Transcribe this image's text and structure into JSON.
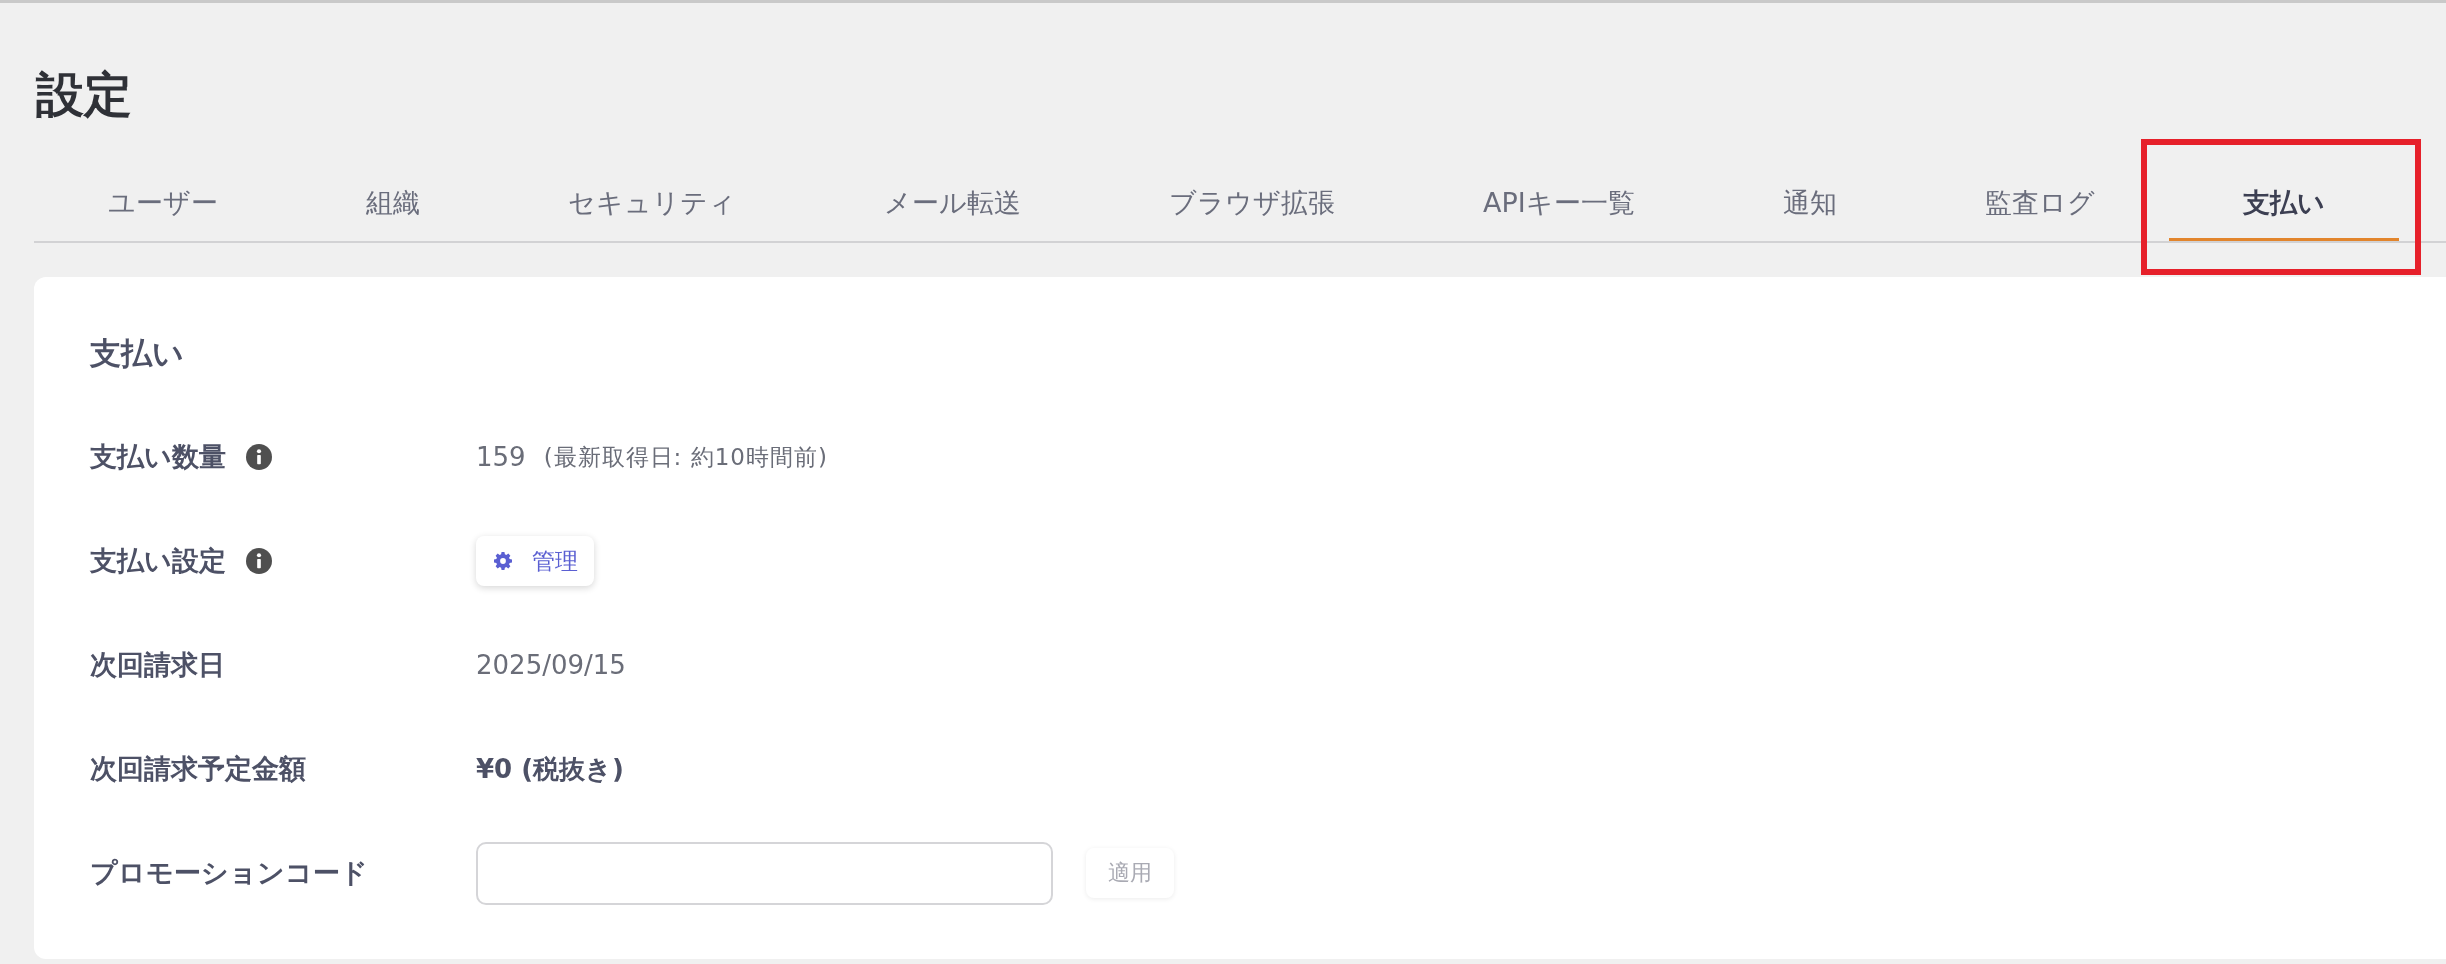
{
  "page": {
    "title": "設定"
  },
  "tabs": [
    {
      "label": "ユーザー",
      "selected": false,
      "highlighted": false
    },
    {
      "label": "組織",
      "selected": false,
      "highlighted": false
    },
    {
      "label": "セキュリティ",
      "selected": false,
      "highlighted": false
    },
    {
      "label": "メール転送",
      "selected": false,
      "highlighted": false
    },
    {
      "label": "ブラウザ拡張",
      "selected": false,
      "highlighted": false
    },
    {
      "label": "APIキー一覧",
      "selected": false,
      "highlighted": false
    },
    {
      "label": "通知",
      "selected": false,
      "highlighted": false
    },
    {
      "label": "監査ログ",
      "selected": false,
      "highlighted": false
    },
    {
      "label": "支払い",
      "selected": true,
      "highlighted": true
    }
  ],
  "section": {
    "heading": "支払い",
    "rows": [
      {
        "kind": "text",
        "label": "支払い数量",
        "info": true,
        "value": "159",
        "note": "(最新取得日: 約10時間前)"
      },
      {
        "kind": "button",
        "label": "支払い設定",
        "info": true,
        "button": {
          "label": "管理"
        }
      },
      {
        "kind": "text",
        "label": "次回請求日",
        "info": false,
        "value": "2025/09/15"
      },
      {
        "kind": "amount",
        "label": "次回請求予定金額",
        "info": false,
        "value": "¥0 (税抜き)"
      },
      {
        "kind": "input",
        "label": "プロモーションコード",
        "info": false,
        "button": {
          "label": "適用",
          "disabled": true
        }
      }
    ]
  }
}
